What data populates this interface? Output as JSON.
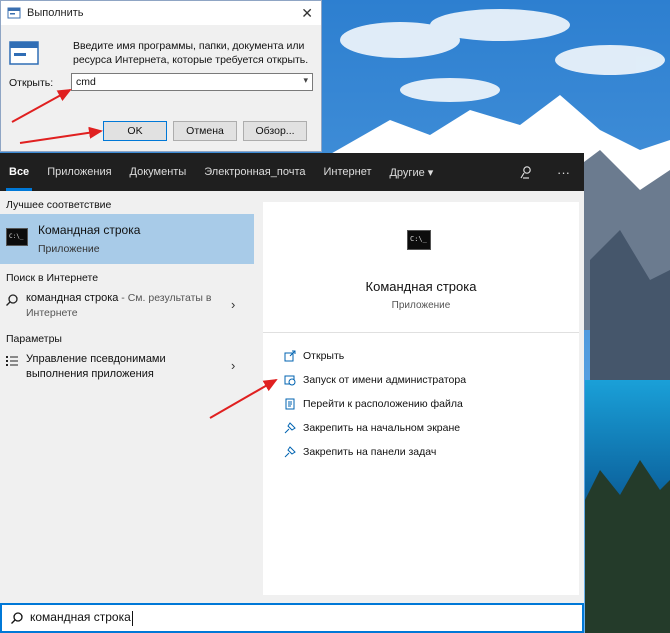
{
  "run_dialog": {
    "title": "Выполнить",
    "close_glyph": "✕",
    "description": "Введите имя программы, папки, документа или ресурса Интернета, которые требуется открыть.",
    "open_label": "Открыть:",
    "input_value": "cmd",
    "ok_label": "OK",
    "cancel_label": "Отмена",
    "browse_label": "Обзор..."
  },
  "search_panel": {
    "tabs": [
      {
        "label": "Все"
      },
      {
        "label": "Приложения"
      },
      {
        "label": "Документы"
      },
      {
        "label": "Электронная_почта"
      },
      {
        "label": "Интернет"
      },
      {
        "label": "Другие ▾"
      }
    ],
    "more_glyph": "···",
    "best_match_heading": "Лучшее соответствие",
    "best_match": {
      "title": "Командная строка",
      "subtitle": "Приложение"
    },
    "web_heading": "Поиск в Интернете",
    "web_result": {
      "query": "командная строка",
      "suffix": " - См. результаты в Интернете"
    },
    "settings_heading": "Параметры",
    "settings_result": {
      "label": "Управление псевдонимами выполнения приложения"
    },
    "preview": {
      "title": "Командная строка",
      "subtitle": "Приложение"
    },
    "actions": [
      {
        "label": "Открыть"
      },
      {
        "label": "Запуск от имени администратора"
      },
      {
        "label": "Перейти к расположению файла"
      },
      {
        "label": "Закрепить на начальном экране"
      },
      {
        "label": "Закрепить на панели задач"
      }
    ],
    "search_text": "командная строка"
  },
  "colors": {
    "accent": "#0078d7",
    "selection": "#a8cbe8",
    "annotation_arrow": "#e02020"
  }
}
